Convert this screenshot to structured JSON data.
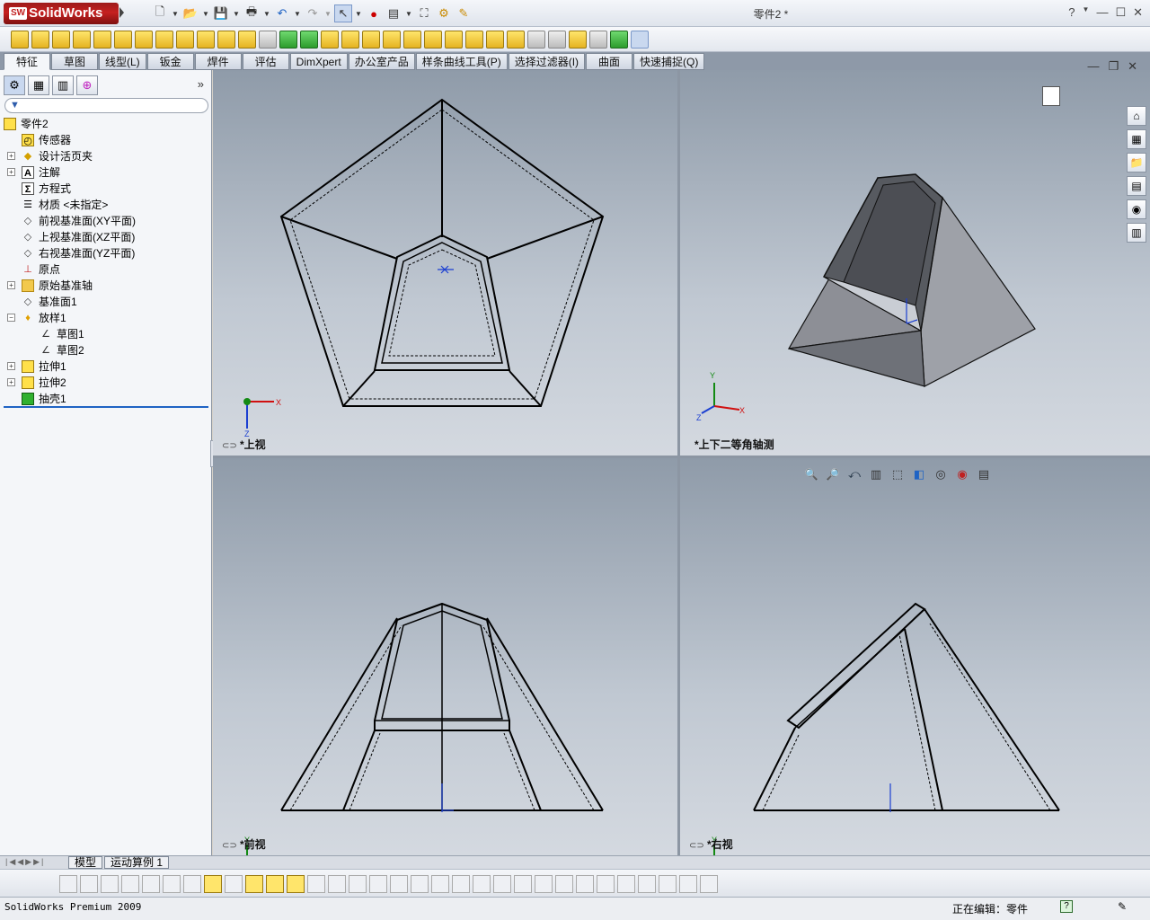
{
  "app": {
    "logo_text": "SolidWorks",
    "logo_badge": "SW",
    "document_title": "零件2 *",
    "help_icon": "?"
  },
  "tabs": [
    {
      "label": "特征",
      "active": true
    },
    {
      "label": "草图"
    },
    {
      "label": "线型(L)"
    },
    {
      "label": "钣金"
    },
    {
      "label": "焊件"
    },
    {
      "label": "评估"
    },
    {
      "label": "DimXpert"
    },
    {
      "label": "办公室产品"
    },
    {
      "label": "样条曲线工具(P)"
    },
    {
      "label": "选择过滤器(I)"
    },
    {
      "label": "曲面"
    },
    {
      "label": "快速捕捉(Q)"
    }
  ],
  "feature_tree": {
    "root": "零件2",
    "items": [
      {
        "label": "传感器",
        "icon": "sensor-icon",
        "level": 1,
        "expand": false
      },
      {
        "label": "设计活页夹",
        "icon": "design-binder-icon",
        "level": 1,
        "expand": true
      },
      {
        "label": "注解",
        "icon": "annotations-icon",
        "level": 1,
        "expand": true
      },
      {
        "label": "方程式",
        "icon": "equations-icon",
        "level": 1,
        "expand": false
      },
      {
        "label": "材质 <未指定>",
        "icon": "material-icon",
        "level": 1,
        "expand": false
      },
      {
        "label": "前视基准面(XY平面)",
        "icon": "plane-icon",
        "level": 1,
        "expand": false
      },
      {
        "label": "上视基准面(XZ平面)",
        "icon": "plane-icon",
        "level": 1,
        "expand": false
      },
      {
        "label": "右视基准面(YZ平面)",
        "icon": "plane-icon",
        "level": 1,
        "expand": false
      },
      {
        "label": "原点",
        "icon": "origin-icon",
        "level": 1,
        "expand": false
      },
      {
        "label": "原始基准轴",
        "icon": "folder-icon",
        "level": 1,
        "expand": true
      },
      {
        "label": "基准面1",
        "icon": "plane-icon",
        "level": 1,
        "expand": false
      },
      {
        "label": "放样1",
        "icon": "loft-icon",
        "level": 1,
        "expand": true,
        "open": true
      },
      {
        "label": "草图1",
        "icon": "sketch-icon",
        "level": 2,
        "expand": false
      },
      {
        "label": "草图2",
        "icon": "sketch-icon",
        "level": 2,
        "expand": false
      },
      {
        "label": "拉伸1",
        "icon": "extrude-icon",
        "level": 1,
        "expand": true
      },
      {
        "label": "拉伸2",
        "icon": "extrude-icon",
        "level": 1,
        "expand": true
      },
      {
        "label": "抽壳1",
        "icon": "shell-icon",
        "level": 1,
        "expand": false
      }
    ]
  },
  "viewports": {
    "top_label": "*上视",
    "iso_label": "*上下二等角轴测",
    "front_label": "*前视",
    "right_label": "*右视"
  },
  "triad": {
    "x": "X",
    "y": "Y",
    "z": "Z"
  },
  "bottom_tabs": {
    "model": "模型",
    "motion": "运动算例 1"
  },
  "status": {
    "product": "SolidWorks Premium 2009",
    "editing": "正在编辑：零件",
    "help": "?"
  },
  "colors": {
    "accent": "#1f63c4",
    "viewport_top": "#8f9ba9",
    "viewport_bottom": "#d4d9e0",
    "logo_red": "#c62020"
  }
}
